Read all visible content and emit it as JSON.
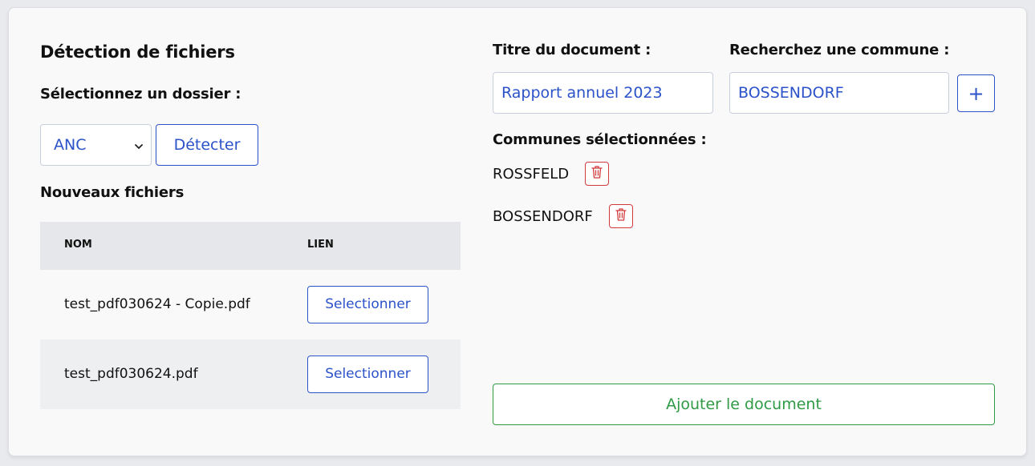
{
  "left": {
    "title": "Détection de fichiers",
    "folder_label": "Sélectionnez un dossier :",
    "folder_select": {
      "selected": "ANC"
    },
    "detect_button": "Détecter",
    "new_files_title": "Nouveaux fichiers",
    "table": {
      "headers": [
        "NOM",
        "LIEN"
      ],
      "rows": [
        {
          "name": "test_pdf030624 - Copie.pdf",
          "action": "Selectionner"
        },
        {
          "name": "test_pdf030624.pdf",
          "action": "Selectionner"
        }
      ]
    }
  },
  "right": {
    "doc_title_label": "Titre du document :",
    "doc_title_value": "Rapport annuel 2023",
    "commune_search_label": "Recherchez une commune :",
    "commune_search_value": "BOSSENDORF",
    "add_commune_button": "+",
    "selected_label": "Communes sélectionnées :",
    "selected_communes": [
      "ROSSFELD",
      "BOSSENDORF"
    ],
    "submit_button": "Ajouter le document"
  },
  "colors": {
    "accent_blue": "#2b52c9",
    "danger_red": "#d13a3a",
    "success_green": "#2f9a44"
  },
  "icons": {
    "select_arrow": "chevron-down-icon",
    "remove": "trash-icon",
    "add": "plus-icon"
  }
}
